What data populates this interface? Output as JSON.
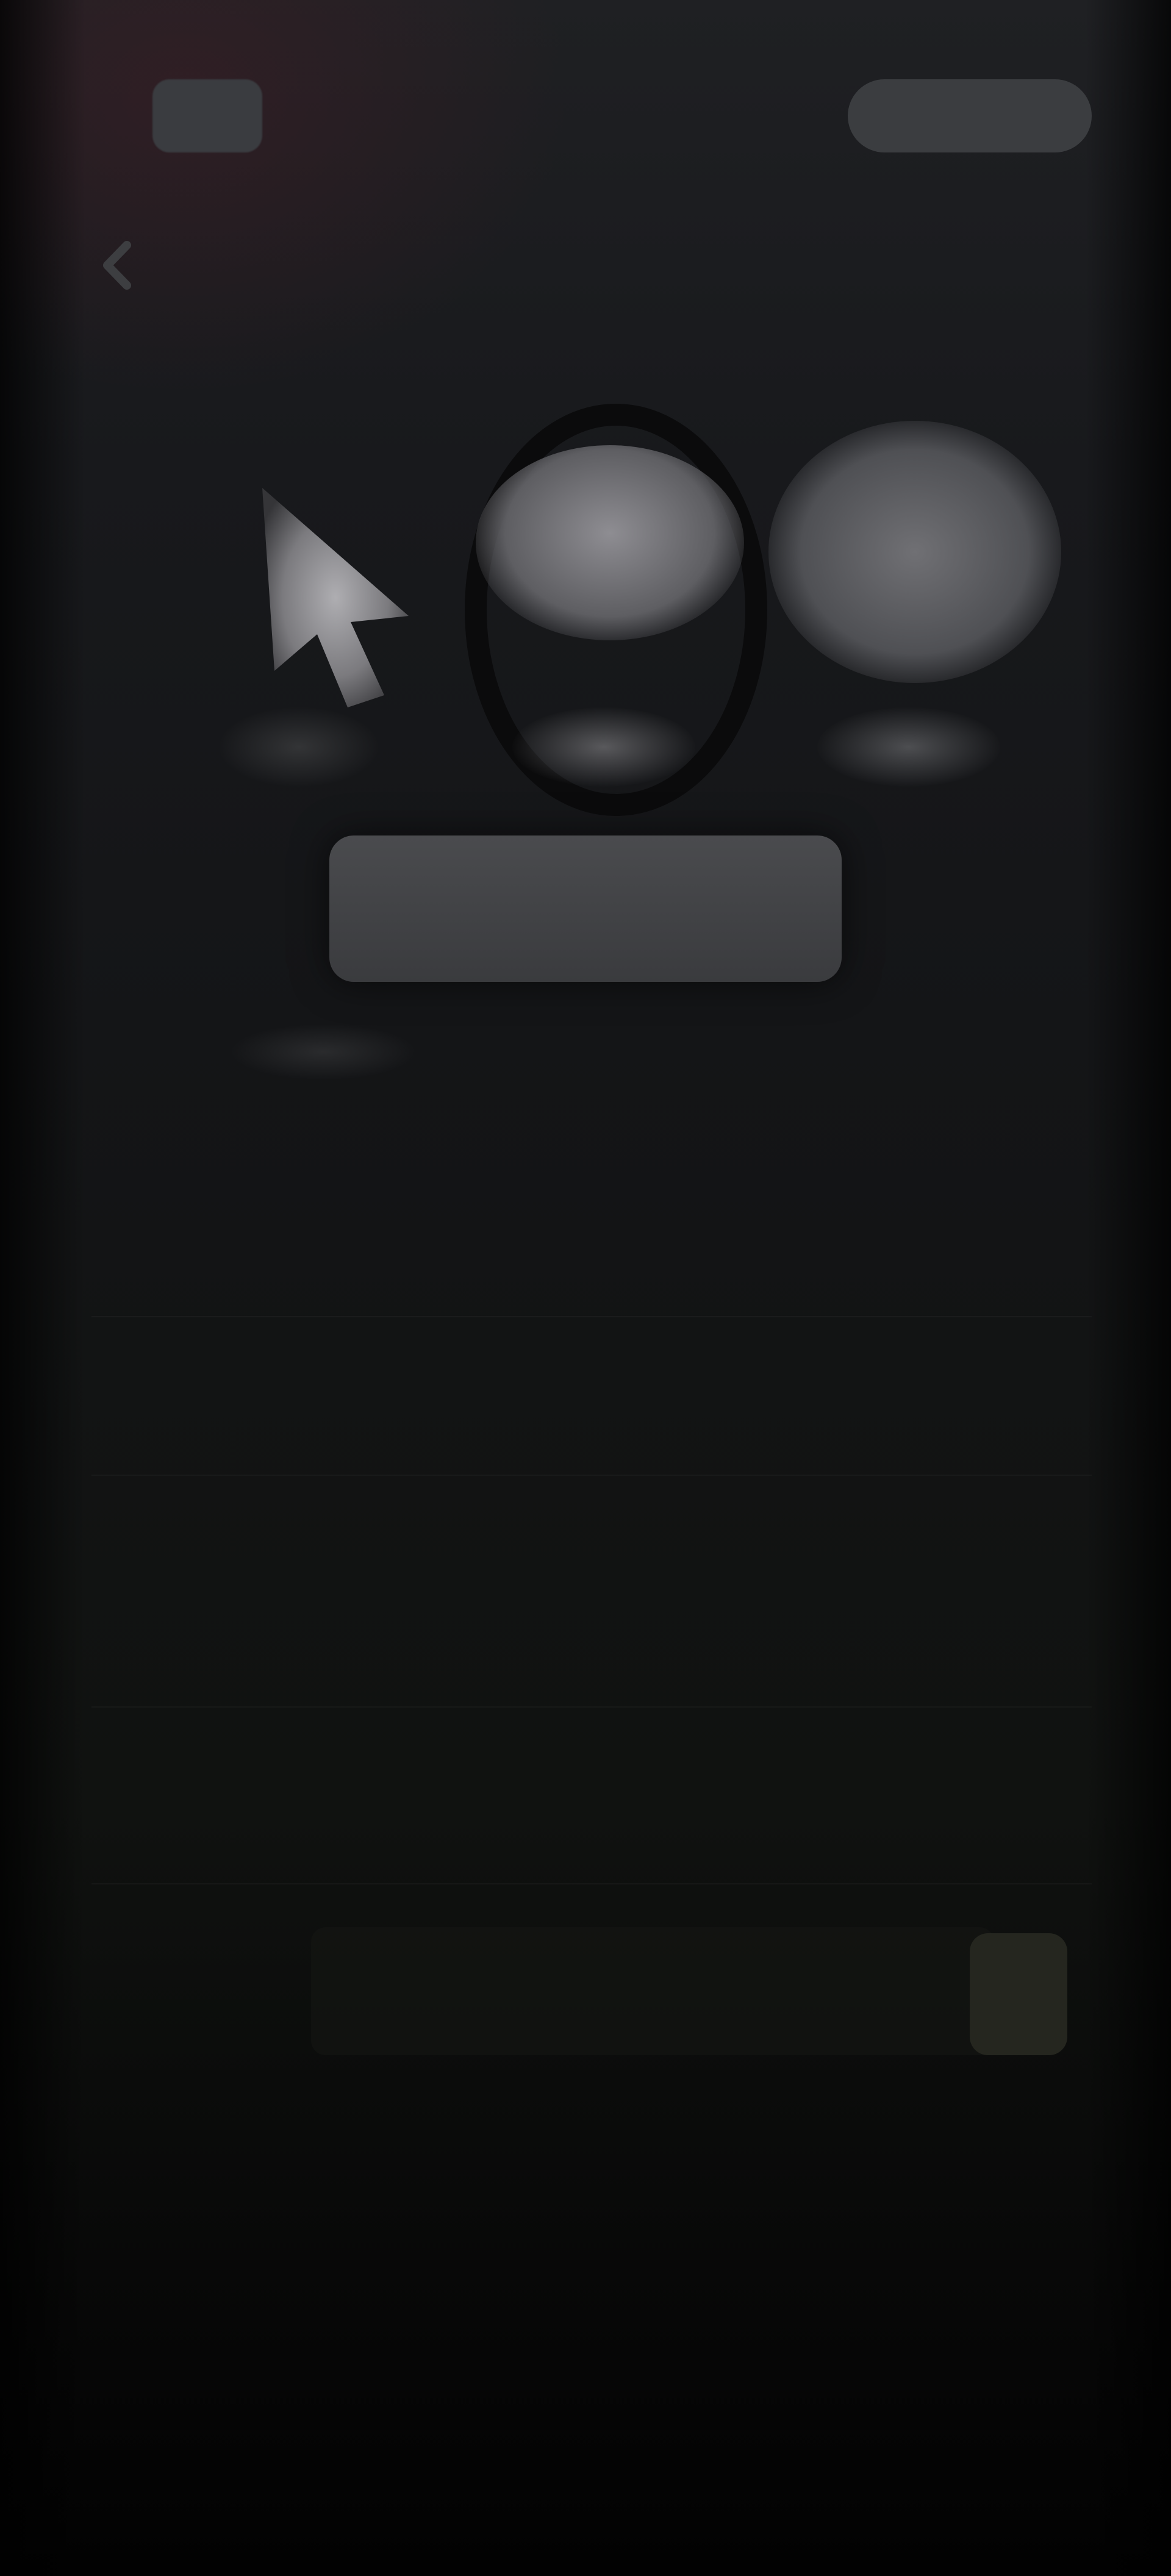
{
  "header": {
    "logo_text": "",
    "pill_label": "",
    "title": ""
  },
  "hero": {
    "action_label": ""
  },
  "settings": {
    "rows": [
      {
        "label": "",
        "value": ""
      },
      {
        "label": "",
        "value": ""
      },
      {
        "label": "",
        "value": ""
      },
      {
        "label": "",
        "value": ""
      },
      {
        "label": "",
        "value": ""
      },
      {
        "label": "",
        "value": ""
      }
    ]
  },
  "icons": {
    "back": "chevron-left-icon"
  },
  "colors": {
    "background_top": "#1f2023",
    "background_bottom": "#020202",
    "surface": "#3b3d40",
    "text": "#8a8b8f"
  }
}
